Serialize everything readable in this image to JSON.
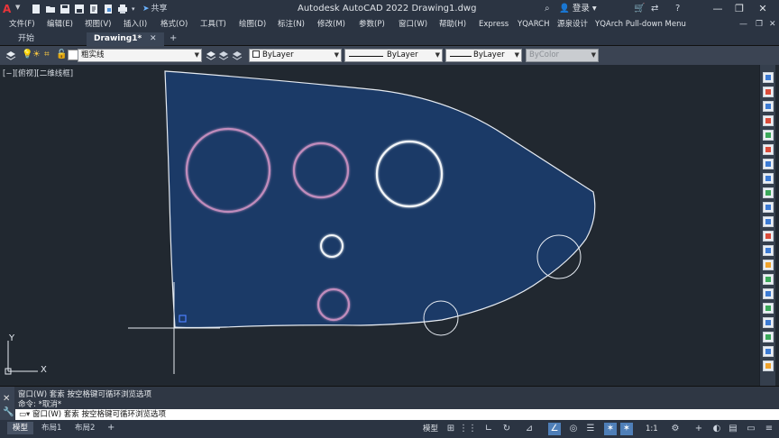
{
  "app": {
    "logo": "A",
    "title": "Autodesk AutoCAD 2022    Drawing1.dwg",
    "share_label": "共享",
    "signin_label": "登录"
  },
  "menus": [
    "文件(F)",
    "编辑(E)",
    "视图(V)",
    "插入(I)",
    "格式(O)",
    "工具(T)",
    "绘图(D)",
    "标注(N)",
    "修改(M)",
    "参数(P)",
    "窗口(W)",
    "帮助(H)",
    "Express",
    "YQARCH",
    "源泉设计",
    "YQArch Pull-down Menu"
  ],
  "tabs": {
    "start": "开始",
    "drawing": "Drawing1*",
    "close": "✕",
    "add": "+"
  },
  "properties": {
    "layer": "粗实线",
    "color": "ByLayer",
    "linetype": "ByLayer",
    "lineweight": "ByLayer",
    "plotstyle": "ByColor"
  },
  "viewport": {
    "label": "[−][俯视][二维线框]"
  },
  "ucs": {
    "x": "X",
    "y": "Y"
  },
  "command": {
    "history_1": "窗口(W)  套索    按空格键可循环浏览选项",
    "history_2": "命令: *取消*",
    "input": "窗口(W) 套索   按空格键可循环浏览选项"
  },
  "layout_tabs": {
    "model": "模型",
    "layout1": "布局1",
    "layout2": "布局2",
    "add": "+"
  },
  "status": {
    "model": "模型",
    "scale": "1:1"
  },
  "colors": {
    "shape_fill": "#1b3a67",
    "shape_stroke": "#e6ebf2",
    "circle_pink": "#c08cbc",
    "circle_white": "#f2f5f8",
    "background": "#212830"
  }
}
